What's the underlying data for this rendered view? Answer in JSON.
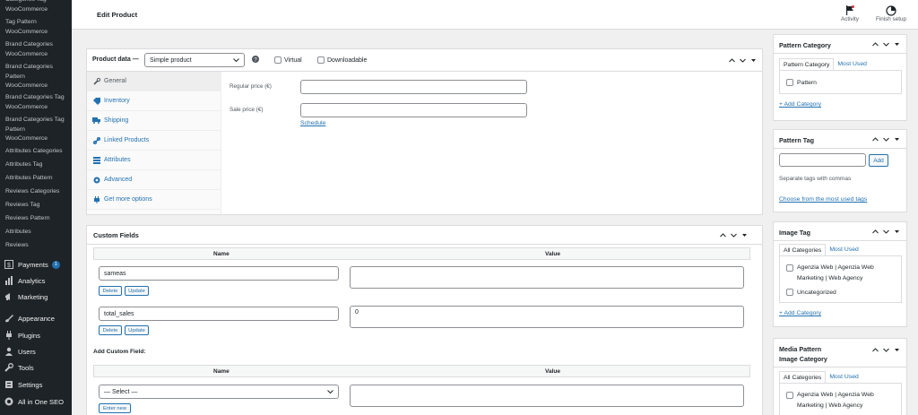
{
  "sidebar": {
    "submenu": [
      {
        "label": "Categories Tag\nWooCommerce"
      },
      {
        "label": "Tag Pattern\nWooCommerce"
      },
      {
        "label": "Brand Categories\nWooCommerce"
      },
      {
        "label": "Brand Categories\nPattern\nWooCommerce"
      },
      {
        "label": "Brand Categories Tag\nWooCommerce"
      },
      {
        "label": "Brand Categories Tag\nPattern\nWooCommerce"
      },
      {
        "label": "Attributes Categories"
      },
      {
        "label": "Attributes Tag"
      },
      {
        "label": "Attributes Pattern"
      },
      {
        "label": "Reviews Categories"
      },
      {
        "label": "Reviews Tag"
      },
      {
        "label": "Reviews Pattern"
      },
      {
        "label": "Attributes"
      },
      {
        "label": "Reviews"
      }
    ],
    "menu": [
      {
        "label": "Payments",
        "badge": "1",
        "icon": "dollar-icon"
      },
      {
        "label": "Analytics",
        "icon": "bar-chart-icon"
      },
      {
        "label": "Marketing",
        "icon": "megaphone-icon"
      },
      {
        "label": "Appearance",
        "icon": "paintbrush-icon"
      },
      {
        "label": "Plugins",
        "icon": "plug-icon"
      },
      {
        "label": "Users",
        "icon": "users-icon"
      },
      {
        "label": "Tools",
        "icon": "wrench-icon"
      },
      {
        "label": "Settings",
        "icon": "settings-icon"
      },
      {
        "label": "All in One SEO",
        "icon": "aioseo-icon"
      }
    ]
  },
  "topbar": {
    "title": "Edit Product",
    "activity": "Activity",
    "finish_setup": "Finish setup"
  },
  "product_data": {
    "label": "Product data —",
    "type_select": "Simple product",
    "virtual": "Virtual",
    "downloadable": "Downloadable",
    "tabs": [
      {
        "label": "General",
        "icon": "wrench-icon"
      },
      {
        "label": "Inventory",
        "icon": "tag-icon"
      },
      {
        "label": "Shipping",
        "icon": "truck-icon"
      },
      {
        "label": "Linked Products",
        "icon": "link-icon"
      },
      {
        "label": "Attributes",
        "icon": "list-icon"
      },
      {
        "label": "Advanced",
        "icon": "gear-icon"
      },
      {
        "label": "Get more options",
        "icon": "plugin-icon"
      }
    ],
    "regular_price_label": "Regular price (€)",
    "sale_price_label": "Sale price (€)",
    "schedule": "Schedule"
  },
  "custom_fields": {
    "title": "Custom Fields",
    "col_name": "Name",
    "col_value": "Value",
    "rows": [
      {
        "name": "sameas",
        "value": ""
      },
      {
        "name": "total_sales",
        "value": "0"
      }
    ],
    "delete": "Delete",
    "update": "Update",
    "add_title": "Add Custom Field:",
    "select_placeholder": "— Select —",
    "enter_new": "Enter new"
  },
  "pattern_category": {
    "title": "Pattern Category",
    "tab_all": "Pattern Category",
    "tab_most": "Most Used",
    "items": [
      "Pattern"
    ],
    "add": "+ Add Category"
  },
  "pattern_tag": {
    "title": "Pattern Tag",
    "add_btn": "Add",
    "hint": "Separate tags with commas",
    "choose": "Choose from the most used tags"
  },
  "image_tag": {
    "title": "Image Tag",
    "tab_all": "All Categories",
    "tab_most": "Most Used",
    "items": [
      "Agenzia Web | Agenzia Web\nMarketing | Web Agency",
      "Uncategorized"
    ],
    "add": "+ Add Category"
  },
  "media_pattern": {
    "title": "Media Pattern\nImage Category",
    "tab_all": "All Categories",
    "tab_most": "Most Used",
    "items": [
      "Agenzia Web | Agenzia Web\nMarketing | Web Agency"
    ]
  },
  "colors": {
    "accent": "#2271b1",
    "sidebar": "#1d2327"
  }
}
